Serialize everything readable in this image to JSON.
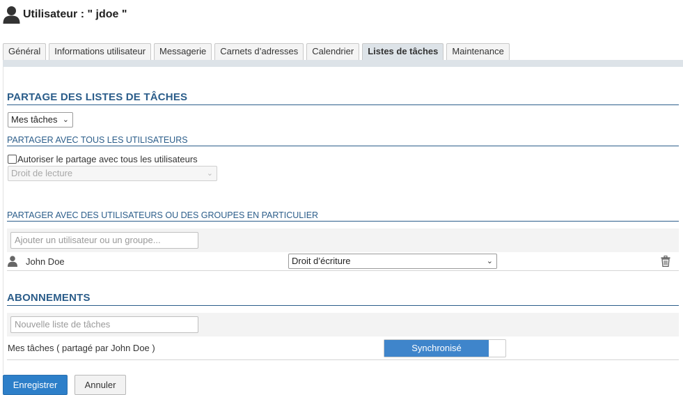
{
  "header": {
    "title": "Utilisateur : \" jdoe \"",
    "icon": "user-icon"
  },
  "tabs": [
    {
      "label": "Général",
      "active": false
    },
    {
      "label": "Informations utilisateur",
      "active": false
    },
    {
      "label": "Messagerie",
      "active": false
    },
    {
      "label": "Carnets d’adresses",
      "active": false
    },
    {
      "label": "Calendrier",
      "active": false
    },
    {
      "label": "Listes de tâches",
      "active": true
    },
    {
      "label": "Maintenance",
      "active": false
    }
  ],
  "sharing": {
    "title": "PARTAGE DES LISTES DE TÂCHES",
    "list_select": "Mes tâches",
    "all_users": {
      "title": "PARTAGER AVEC TOUS LES UTILISATEURS",
      "checkbox_label": "Autoriser le partage avec tous les utilisateurs",
      "checked": false,
      "right_select": "Droit de lecture"
    },
    "particular": {
      "title": "PARTAGER AVEC DES UTILISATEURS OU DES GROUPES EN PARTICULIER",
      "add_placeholder": "Ajouter un utilisateur ou un groupe...",
      "entries": [
        {
          "name": "John Doe",
          "right": "Droit d’écriture",
          "icon": "user-icon",
          "delete_icon": "trash-icon"
        }
      ]
    }
  },
  "subscriptions": {
    "title": "ABONNEMENTS",
    "new_placeholder": "Nouvelle liste de tâches",
    "items": [
      {
        "label": "Mes tâches ( partagé par John Doe )",
        "toggle_label": "Synchronisé",
        "synchronized": true
      }
    ]
  },
  "footer": {
    "save_label": "Enregistrer",
    "cancel_label": "Annuler"
  },
  "colors": {
    "accent": "#2b5d8a",
    "primary_button": "#2d7fc9",
    "toggle_on": "#3f85cb",
    "tab_active": "#dde3e8"
  }
}
